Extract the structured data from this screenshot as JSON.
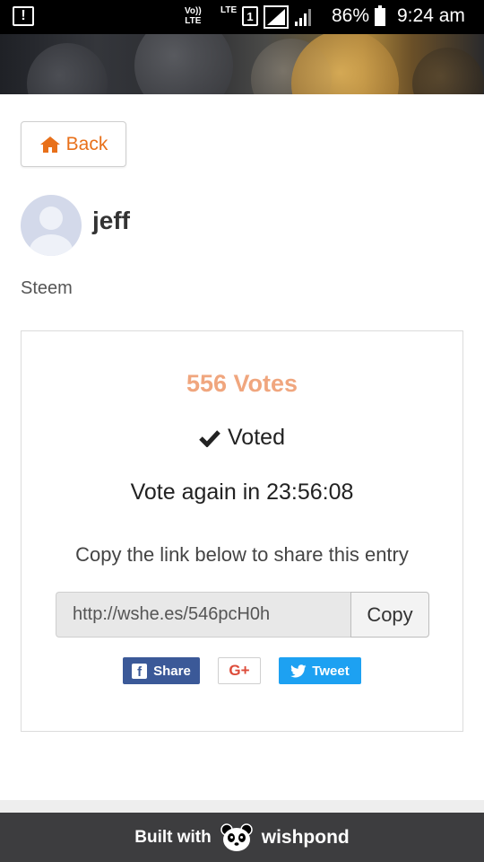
{
  "status_bar": {
    "alert_icon": "!",
    "network_volte": "Vo))\nLTE",
    "network_lte": "LTE",
    "sim_slot": "1",
    "battery_percent": "86%",
    "time": "9:24 am"
  },
  "nav": {
    "back_label": "Back"
  },
  "profile": {
    "username": "jeff",
    "platform": "Steem"
  },
  "vote_card": {
    "votes_label": "556 Votes",
    "voted_label": "Voted",
    "vote_again_label": "Vote again in 23:56:08",
    "share_hint": "Copy the link below to share this entry",
    "share_link": "http://wshe.es/546pcH0h",
    "copy_label": "Copy",
    "social": {
      "facebook_label": "Share",
      "gplus_label": "G+",
      "twitter_label": "Tweet"
    }
  },
  "footer": {
    "built_with": "Built with",
    "brand": "wishpond"
  },
  "colors": {
    "accent_orange": "#e8701a",
    "votes_color": "#f0a67e",
    "facebook": "#3b5998",
    "twitter": "#1da1f2",
    "gplus": "#dd4b39",
    "footer_bg": "#3d3d3f"
  }
}
